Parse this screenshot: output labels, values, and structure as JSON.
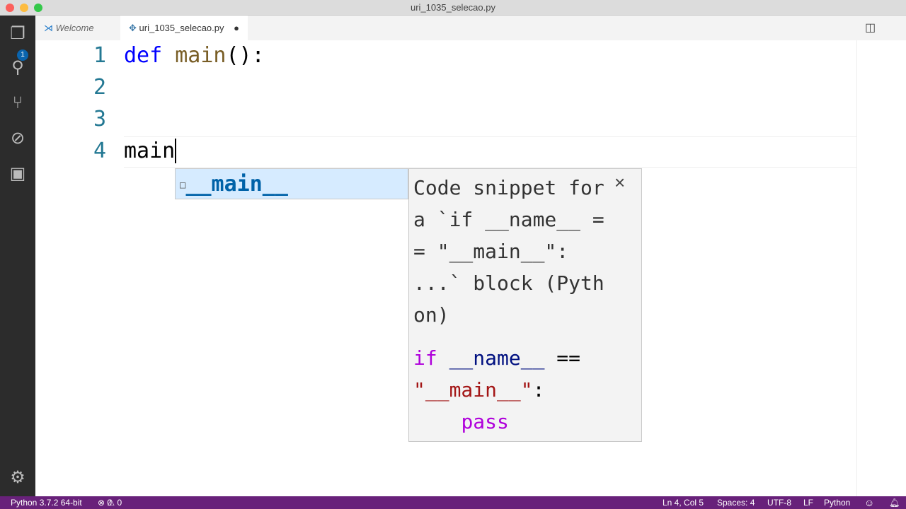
{
  "window": {
    "title": "uri_1035_selecao.py"
  },
  "activity": {
    "badge": "1"
  },
  "tabs": [
    {
      "label": "Welcome"
    },
    {
      "label": "uri_1035_selecao.py"
    }
  ],
  "editor": {
    "line_numbers": [
      "1",
      "2",
      "3",
      "4"
    ],
    "line1": {
      "kw": "def",
      "fn": "main",
      "rest": "():"
    },
    "line4": "main"
  },
  "suggest": {
    "item": "__main__"
  },
  "doc": {
    "description": "Code snippet for a `if __name__ == \"__main__\": ...` block (Python)",
    "close": "×",
    "code": {
      "if": "if",
      "name": "__name__",
      "eq": " ==",
      "str": "\"__main__\"",
      "colon": ":",
      "pass": "pass"
    }
  },
  "status": {
    "interpreter": "Python 3.7.2 64-bit",
    "errors": "0",
    "warnings": "0",
    "position": "Ln 4, Col 5",
    "spaces": "Spaces: 4",
    "encoding": "UTF-8",
    "eol": "LF",
    "language": "Python"
  },
  "colors": {
    "statusbar": "#68217a",
    "keyword": "#0000ff",
    "string": "#a31515",
    "control": "#af00db"
  }
}
